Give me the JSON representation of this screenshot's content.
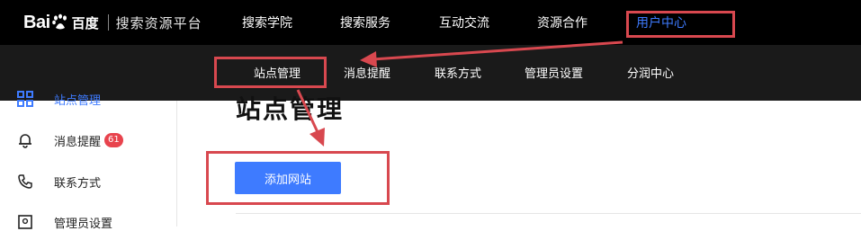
{
  "brand": {
    "logo_latin": "Bai",
    "logo_cn": "百度",
    "product": "搜索资源平台",
    "accent_color": "#3e7bff",
    "annotation_color": "#d8484f"
  },
  "top_nav": {
    "items": [
      {
        "label": "搜索学院"
      },
      {
        "label": "搜索服务"
      },
      {
        "label": "互动交流"
      },
      {
        "label": "资源合作"
      },
      {
        "label": "用户中心"
      }
    ],
    "active": "用户中心"
  },
  "sub_nav": {
    "items": [
      {
        "label": "站点管理"
      },
      {
        "label": "消息提醒"
      },
      {
        "label": "联系方式"
      },
      {
        "label": "管理员设置"
      },
      {
        "label": "分润中心"
      }
    ],
    "active": "站点管理"
  },
  "sidebar": {
    "items": [
      {
        "label": "站点管理",
        "icon": "sites-grid-icon"
      },
      {
        "label": "消息提醒",
        "icon": "bell-icon",
        "badge": "61"
      },
      {
        "label": "联系方式",
        "icon": "phone-icon"
      },
      {
        "label": "管理员设置",
        "icon": "admin-settings-icon"
      }
    ],
    "active": "站点管理"
  },
  "main": {
    "title": "站点管理",
    "add_button": "添加网站"
  }
}
